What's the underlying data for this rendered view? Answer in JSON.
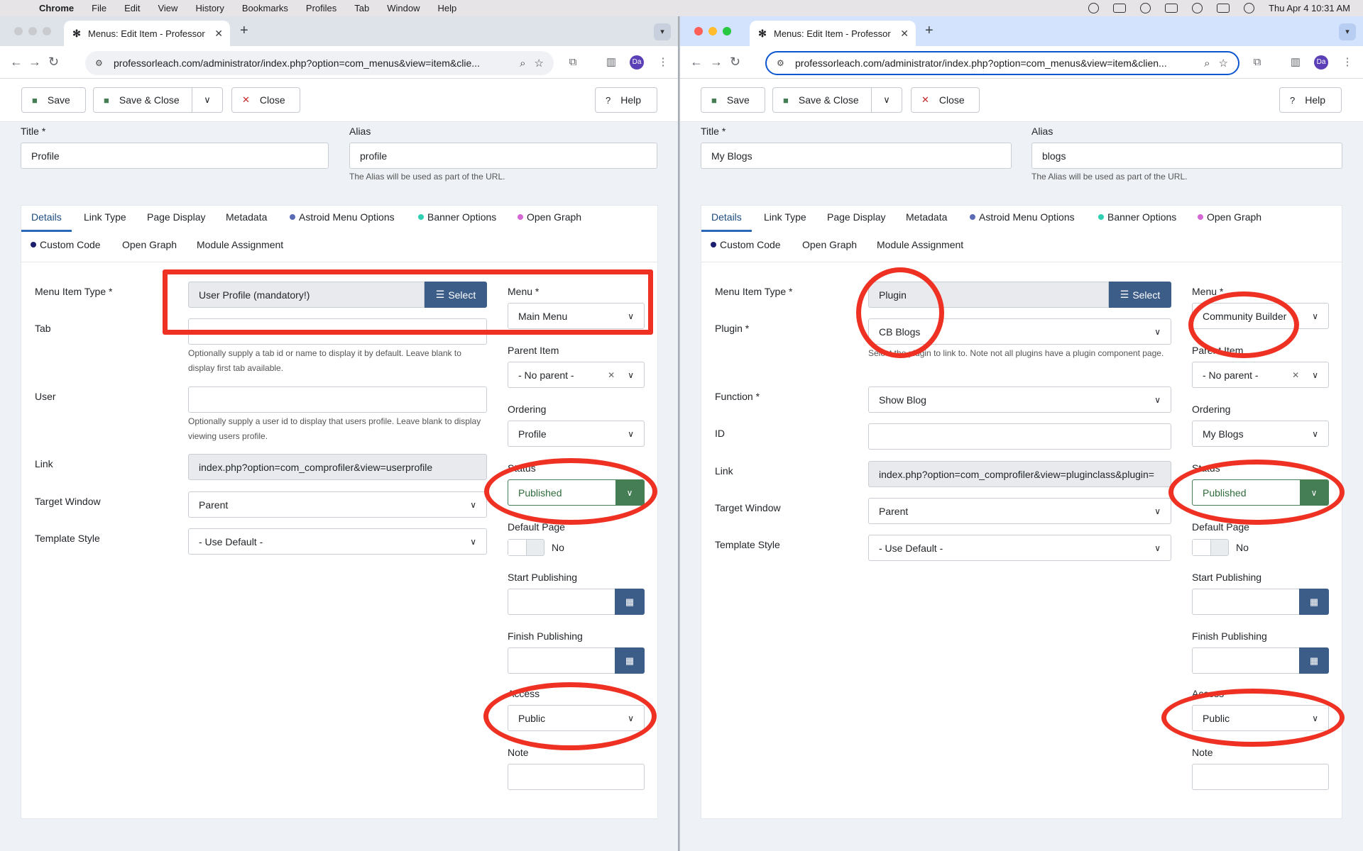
{
  "menubar": {
    "apple": "",
    "app": "Chrome",
    "items": [
      "File",
      "Edit",
      "View",
      "History",
      "Bookmarks",
      "Profiles",
      "Tab",
      "Window",
      "Help"
    ],
    "clock": "Thu Apr 4  10:31 AM"
  },
  "colors": {
    "accent": "#3d5d89",
    "published": "#457d54",
    "annotation_red": "#ef3124",
    "tab_active": "#2a69b8"
  },
  "left": {
    "tab_title": "Menus: Edit Item - Professor",
    "tab_close": "✕",
    "new_tab": "+",
    "url": "professorleach.com/administrator/index.php?option=com_menus&view=item&clie...",
    "avatar": "Da",
    "toolbar": {
      "save": "Save",
      "save_close": "Save & Close",
      "close": "Close",
      "help": "Help"
    },
    "title_label": "Title *",
    "title_value": "Profile",
    "alias_label": "Alias",
    "alias_value": "profile",
    "alias_hint": "The Alias will be used as part of the URL.",
    "tabs": {
      "details": "Details",
      "link_type": "Link Type",
      "page_display": "Page Display",
      "metadata": "Metadata",
      "astroid": "Astroid Menu Options",
      "banner": "Banner Options",
      "open_graph1": "Open Graph",
      "custom_code": "Custom Code",
      "open_graph2": "Open Graph",
      "module_assignment": "Module Assignment"
    },
    "fields": {
      "menu_item_type_label": "Menu Item Type *",
      "menu_item_type_value": "User Profile (mandatory!)",
      "select_label": "Select",
      "tab_label": "Tab",
      "tab_value": "",
      "tab_hint": "Optionally supply a tab id or name to display it by default. Leave blank to display first tab available.",
      "user_label": "User",
      "user_value": "",
      "user_hint": "Optionally supply a user id to display that users profile. Leave blank to display viewing users profile.",
      "link_label": "Link",
      "link_value": "index.php?option=com_comprofiler&view=userprofile",
      "target_label": "Target Window",
      "target_value": "Parent",
      "template_label": "Template Style",
      "template_value": "- Use Default -"
    },
    "side": {
      "menu_label": "Menu *",
      "menu_value": "Main Menu",
      "parent_label": "Parent Item",
      "parent_value": "- No parent -",
      "ordering_label": "Ordering",
      "ordering_value": "Profile",
      "status_label": "Status",
      "status_value": "Published",
      "default_label": "Default Page",
      "default_value": "No",
      "start_label": "Start Publishing",
      "finish_label": "Finish Publishing",
      "access_label": "Access",
      "access_value": "Public",
      "note_label": "Note"
    }
  },
  "right": {
    "tab_title": "Menus: Edit Item - Professor",
    "tab_close": "✕",
    "new_tab": "+",
    "url": "professorleach.com/administrator/index.php?option=com_menus&view=item&clien...",
    "avatar": "Da",
    "toolbar": {
      "save": "Save",
      "save_close": "Save & Close",
      "close": "Close",
      "help": "Help"
    },
    "title_label": "Title *",
    "title_value": "My Blogs",
    "alias_label": "Alias",
    "alias_value": "blogs",
    "alias_hint": "The Alias will be used as part of the URL.",
    "tabs": {
      "details": "Details",
      "link_type": "Link Type",
      "page_display": "Page Display",
      "metadata": "Metadata",
      "astroid": "Astroid Menu Options",
      "banner": "Banner Options",
      "open_graph1": "Open Graph",
      "custom_code": "Custom Code",
      "open_graph2": "Open Graph",
      "module_assignment": "Module Assignment"
    },
    "fields": {
      "menu_item_type_label": "Menu Item Type *",
      "menu_item_type_value": "Plugin",
      "select_label": "Select",
      "plugin_label": "Plugin *",
      "plugin_value": "CB Blogs",
      "plugin_hint": "Select the plugin to link to. Note not all plugins have a plugin component page.",
      "function_label": "Function *",
      "function_value": "Show Blog",
      "id_label": "ID",
      "id_value": "",
      "link_label": "Link",
      "link_value": "index.php?option=com_comprofiler&view=pluginclass&plugin=",
      "target_label": "Target Window",
      "target_value": "Parent",
      "template_label": "Template Style",
      "template_value": "- Use Default -"
    },
    "side": {
      "menu_label": "Menu *",
      "menu_value": "Community Builder",
      "parent_label": "Parent Item",
      "parent_value": "- No parent -",
      "ordering_label": "Ordering",
      "ordering_value": "My Blogs",
      "status_label": "Status",
      "status_value": "Published",
      "default_label": "Default Page",
      "default_value": "No",
      "start_label": "Start Publishing",
      "finish_label": "Finish Publishing",
      "access_label": "Access",
      "access_value": "Public",
      "note_label": "Note"
    }
  }
}
